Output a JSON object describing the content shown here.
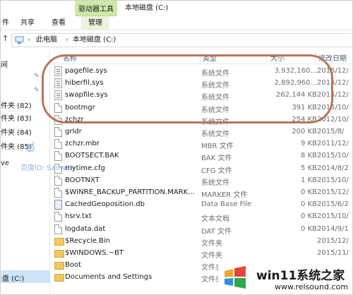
{
  "ribbon": {
    "context_tab": "驱动器工具",
    "window_title": "本地磁盘 (C:)",
    "tabs": [
      "件",
      "共享",
      "查看",
      "管理"
    ]
  },
  "address": {
    "crumbs": [
      "此电脑",
      "本地磁盘 (C:)"
    ]
  },
  "sidebar": {
    "items": [
      {
        "label": "间"
      },
      {
        "label": "件夹 (82)"
      },
      {
        "label": "件夹 (83)"
      },
      {
        "label": "件夹 (84)"
      },
      {
        "label": "件夹 (85)"
      },
      {
        "label": "ve"
      },
      {
        "label": "盘 (C:)"
      }
    ]
  },
  "columns": {
    "name": "名称",
    "type": "类型",
    "size": "大小",
    "date": "修改日期"
  },
  "files": [
    {
      "name": "pagefile.sys",
      "type": "系统文件",
      "size": "3,932,160...",
      "date": "2015/12/",
      "icon": "system-file"
    },
    {
      "name": "hiberfil.sys",
      "type": "系统文件",
      "size": "2,892,960...",
      "date": "2015/12/",
      "icon": "system-file"
    },
    {
      "name": "swapfile.sys",
      "type": "系统文件",
      "size": "262,144 KB",
      "date": "2015/12/",
      "icon": "system-file"
    },
    {
      "name": "bootmgr",
      "type": "系统文件",
      "size": "391 KB",
      "date": "2015/10/",
      "icon": "file"
    },
    {
      "name": "zchzr",
      "type": "系统文件",
      "size": "254 KB",
      "date": "2012/10/",
      "icon": "file"
    },
    {
      "name": "grldr",
      "type": "系统文件",
      "size": "200 KB",
      "date": "2015/8/",
      "icon": "file"
    },
    {
      "name": "zchzr.mbr",
      "type": "MBR 文件",
      "size": "9 KB",
      "date": "2011/12/",
      "icon": "file"
    },
    {
      "name": "BOOTSECT.BAK",
      "type": "BAK 文件",
      "size": "8 KB",
      "date": "2015/10/",
      "icon": "file"
    },
    {
      "name": "mytime.cfg",
      "type": "CFG 文件",
      "size": "5 KB",
      "date": "2014/8/2",
      "icon": "file"
    },
    {
      "name": "BOOTNXT",
      "type": "系统文件",
      "size": "1 KB",
      "date": "2015/10/",
      "icon": "file"
    },
    {
      "name": "$WINRE_BACKUP_PARTITION.MARK...",
      "type": "MARKER 文件",
      "size": "0 KB",
      "date": "2015/12/",
      "icon": "file"
    },
    {
      "name": "CachedGeoposition.db",
      "type": "Data Base File",
      "size": "0 KB",
      "date": "2015/6/2",
      "icon": "database"
    },
    {
      "name": "hsrv.txt",
      "type": "文本文档",
      "size": "0 KB",
      "date": "2015/10/",
      "icon": "file"
    },
    {
      "name": "logdata.dat",
      "type": "DAT 文件",
      "size": "0 KB",
      "date": "2014/9/1",
      "icon": "file"
    },
    {
      "name": "$Recycle.Bin",
      "type": "文件夹",
      "size": "",
      "date": "2015/12/",
      "icon": "folder"
    },
    {
      "name": "$WINDOWS.~BT",
      "type": "文件夹",
      "size": "",
      "date": "2015/11/",
      "icon": "folder"
    },
    {
      "name": "Boot",
      "type": "文件夹",
      "size": "",
      "date": "",
      "icon": "folder"
    },
    {
      "name": "Documents and Settings",
      "type": "文件夹",
      "size": "",
      "date": "",
      "icon": "folder"
    }
  ],
  "watermarks": {
    "left_text": "百度ID: Sanwith",
    "brand_name": "win11系统之家",
    "brand_url": "www.relsound.com",
    "brand_colors": [
      "#f2a52b",
      "#e2463b",
      "#2f8fe0",
      "#2fa64a"
    ]
  },
  "colors": {
    "context_tab": "#cfe8a8",
    "selection": "#cce4f7",
    "highlight_oval": "#b9765c"
  }
}
